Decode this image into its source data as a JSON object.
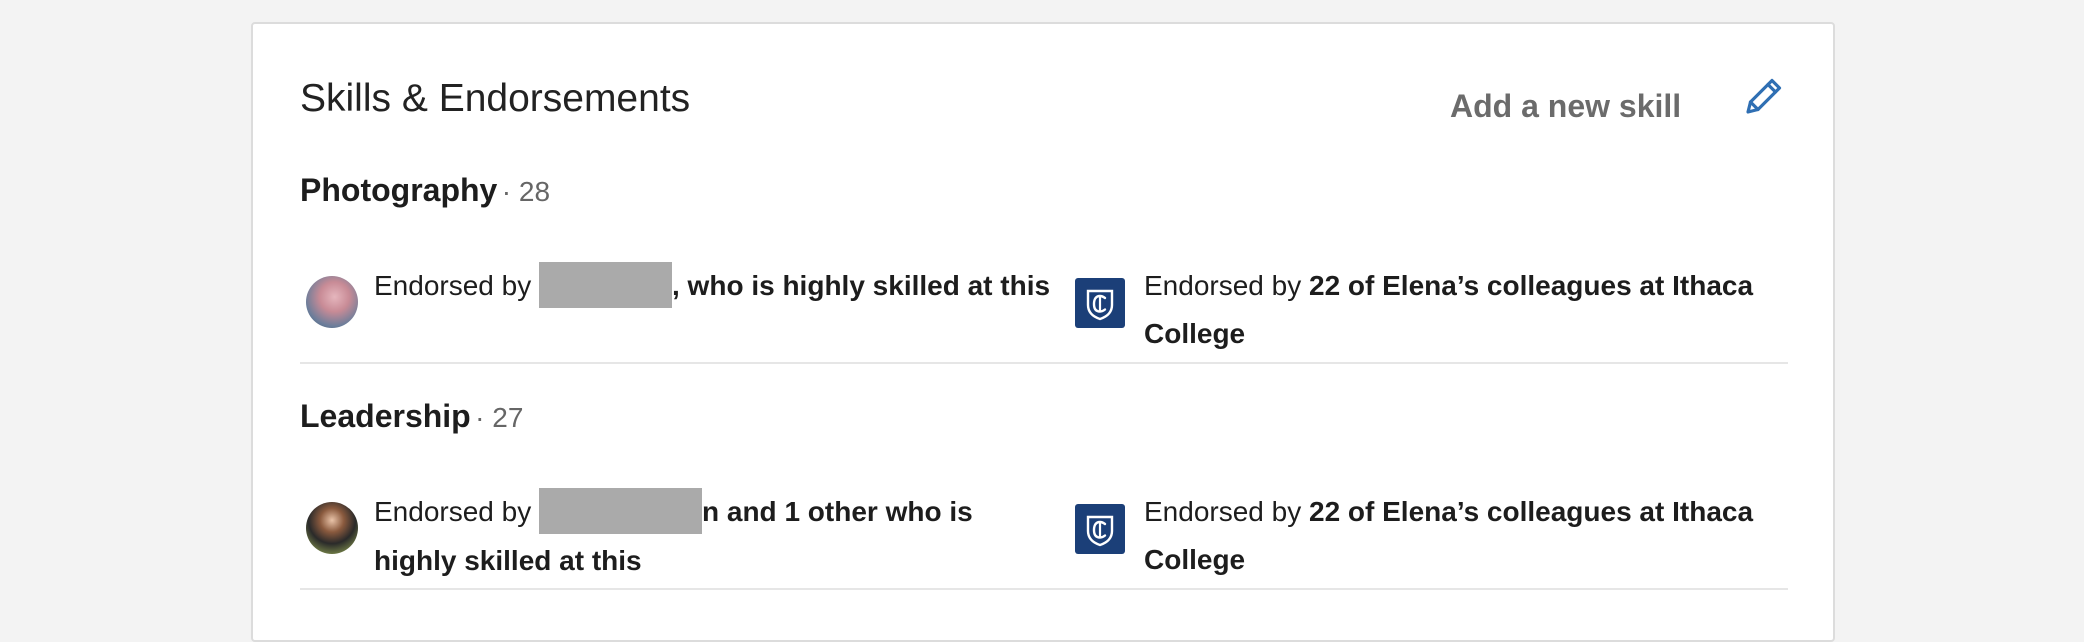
{
  "section": {
    "title": "Skills & Endorsements",
    "add_skill_label": "Add a new skill",
    "edit_icon": "pencil-icon"
  },
  "skills": [
    {
      "name": "Photography",
      "count": "· 28",
      "person_endorsement": {
        "prefix": "Endorsed by",
        "suffix": ", who is highly skilled at this",
        "avatar": "avatar-photo"
      },
      "college_endorsement": {
        "prefix": "Endorsed by",
        "emphasis": "22 of Elena’s colleagues at Ithaca College",
        "logo": "ithaca-college-logo"
      }
    },
    {
      "name": "Leadership",
      "count": "· 27",
      "person_endorsement": {
        "prefix": "Endorsed by",
        "suffix": "n and 1 other who is highly skilled at this",
        "avatar": "avatar-photo"
      },
      "college_endorsement": {
        "prefix": "Endorsed by",
        "emphasis": "22 of Elena’s colleagues at Ithaca College",
        "logo": "ithaca-college-logo"
      }
    }
  ],
  "colors": {
    "page_background": "#f3f3f3",
    "card_background": "#ffffff",
    "accent_blue": "#2f6fb3",
    "college_blue": "#1b3f78",
    "redaction_gray": "#aaaaaa"
  }
}
